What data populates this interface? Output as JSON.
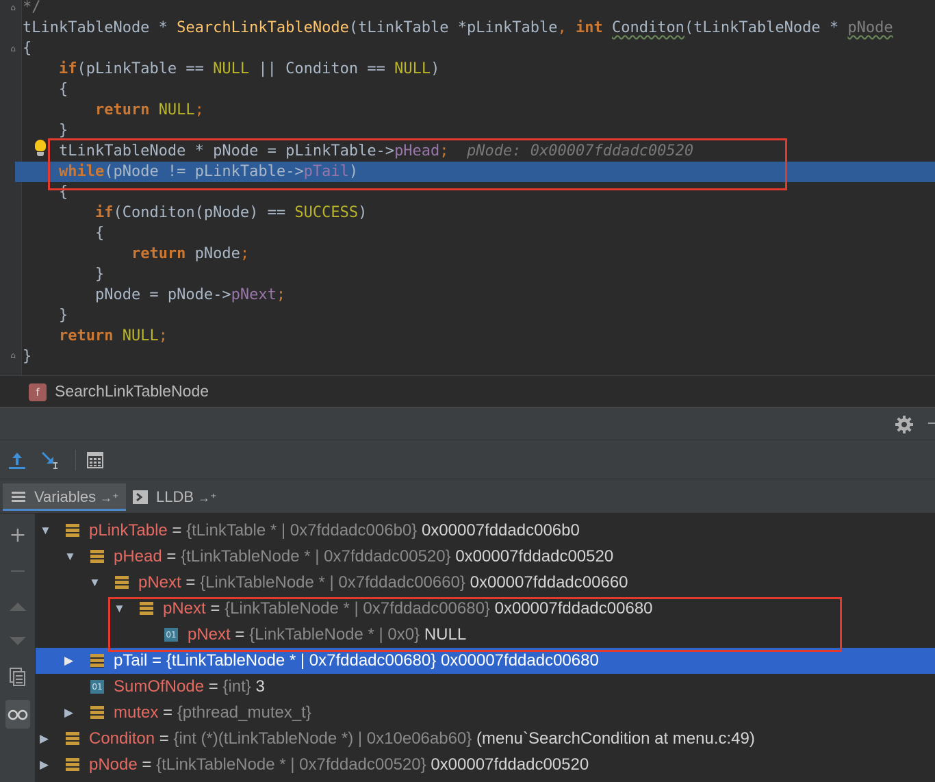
{
  "editor": {
    "lines": [
      {
        "parts": [
          {
            "t": "*/",
            "c": "cmt"
          }
        ]
      },
      {
        "parts": [
          {
            "t": "tLinkTableNode * ",
            "c": "pl"
          },
          {
            "t": "SearchLinkTableNode",
            "c": "fn"
          },
          {
            "t": "(tLinkTable *pLinkTable",
            "c": "pl"
          },
          {
            "t": ", ",
            "c": "punct"
          },
          {
            "t": "int ",
            "c": "kw"
          },
          {
            "t": "Conditon",
            "c": "pl squig"
          },
          {
            "t": "(tLinkTableNode * ",
            "c": "pl"
          },
          {
            "t": "pNode",
            "c": "cmt squig"
          }
        ]
      },
      {
        "parts": [
          {
            "t": "{",
            "c": "pl"
          }
        ]
      },
      {
        "parts": [
          {
            "t": "    ",
            "c": "pl"
          },
          {
            "t": "if",
            "c": "kw"
          },
          {
            "t": "(pLinkTable == ",
            "c": "pl"
          },
          {
            "t": "NULL",
            "c": "mac"
          },
          {
            "t": " || Conditon == ",
            "c": "pl"
          },
          {
            "t": "NULL",
            "c": "mac"
          },
          {
            "t": ")",
            "c": "pl"
          }
        ]
      },
      {
        "parts": [
          {
            "t": "    {",
            "c": "pl"
          }
        ]
      },
      {
        "parts": [
          {
            "t": "        ",
            "c": "pl"
          },
          {
            "t": "return ",
            "c": "kw"
          },
          {
            "t": "NULL",
            "c": "mac"
          },
          {
            "t": ";",
            "c": "punct"
          }
        ]
      },
      {
        "parts": [
          {
            "t": "    }",
            "c": "pl"
          }
        ]
      },
      {
        "parts": [
          {
            "t": "    tLinkTableNode * pNode = pLinkTable->",
            "c": "pl"
          },
          {
            "t": "pHead",
            "c": "fld"
          },
          {
            "t": ";",
            "c": "punct"
          },
          {
            "t": "  pNode: 0x00007fddadc00520",
            "c": "inlay"
          }
        ]
      },
      {
        "parts": [
          {
            "t": "    ",
            "c": "pl"
          },
          {
            "t": "while",
            "c": "kwb"
          },
          {
            "t": "(pNode != pLinkTable->",
            "c": "pl"
          },
          {
            "t": "pTail",
            "c": "fld"
          },
          {
            "t": ")",
            "c": "pl"
          }
        ]
      },
      {
        "parts": [
          {
            "t": "    {",
            "c": "pl"
          }
        ]
      },
      {
        "parts": [
          {
            "t": "        ",
            "c": "pl"
          },
          {
            "t": "if",
            "c": "kw"
          },
          {
            "t": "(Conditon(pNode) == ",
            "c": "pl"
          },
          {
            "t": "SUCCESS",
            "c": "mac"
          },
          {
            "t": ")",
            "c": "pl"
          }
        ]
      },
      {
        "parts": [
          {
            "t": "        {",
            "c": "pl"
          }
        ]
      },
      {
        "parts": [
          {
            "t": "            ",
            "c": "pl"
          },
          {
            "t": "return ",
            "c": "kw"
          },
          {
            "t": "pNode",
            "c": "pl"
          },
          {
            "t": ";",
            "c": "punct"
          }
        ]
      },
      {
        "parts": [
          {
            "t": "        }",
            "c": "pl"
          }
        ]
      },
      {
        "parts": [
          {
            "t": "        pNode = pNode->",
            "c": "pl"
          },
          {
            "t": "pNext",
            "c": "fld"
          },
          {
            "t": ";",
            "c": "punct"
          }
        ]
      },
      {
        "parts": [
          {
            "t": "    }",
            "c": "pl"
          }
        ]
      },
      {
        "parts": [
          {
            "t": "    ",
            "c": "pl"
          },
          {
            "t": "return ",
            "c": "kw"
          },
          {
            "t": "NULL",
            "c": "mac"
          },
          {
            "t": ";",
            "c": "punct"
          }
        ]
      },
      {
        "parts": [
          {
            "t": "}",
            "c": "pl"
          }
        ]
      }
    ],
    "execution_line_index": 8
  },
  "breadcrumb": {
    "icon_letter": "f",
    "function_name": "SearchLinkTableNode"
  },
  "tabs": {
    "variables": "Variables",
    "lldb": "LLDB",
    "pin_glyph": "→⁺"
  },
  "variables": [
    {
      "expanded": true,
      "has_children": true,
      "icon": "object",
      "name": "pLinkTable",
      "type": "{tLinkTable * | 0x7fddadc006b0}",
      "value": "0x00007fddadc006b0",
      "depth": 0
    },
    {
      "expanded": true,
      "has_children": true,
      "icon": "object",
      "name": "pHead",
      "type": "{tLinkTableNode * | 0x7fddadc00520}",
      "value": "0x00007fddadc00520",
      "depth": 1
    },
    {
      "expanded": true,
      "has_children": true,
      "icon": "object",
      "name": "pNext",
      "type": "{LinkTableNode * | 0x7fddadc00660}",
      "value": "0x00007fddadc00660",
      "depth": 2
    },
    {
      "expanded": true,
      "has_children": true,
      "icon": "object",
      "name": "pNext",
      "type": "{LinkTableNode * | 0x7fddadc00680}",
      "value": "0x00007fddadc00680",
      "depth": 3
    },
    {
      "expanded": false,
      "has_children": false,
      "icon": "primitive",
      "name": "pNext",
      "type": "{LinkTableNode * | 0x0}",
      "value": "NULL",
      "depth": 4
    },
    {
      "expanded": false,
      "has_children": true,
      "icon": "object",
      "name": "pTail",
      "type": "{tLinkTableNode * | 0x7fddadc00680}",
      "value": "0x00007fddadc00680",
      "depth": 1,
      "selected": true
    },
    {
      "expanded": false,
      "has_children": false,
      "icon": "primitive",
      "name": "SumOfNode",
      "type": "{int}",
      "value": "3",
      "depth": 1
    },
    {
      "expanded": false,
      "has_children": true,
      "icon": "object",
      "name": "mutex",
      "type": "{pthread_mutex_t}",
      "value": "",
      "depth": 1
    },
    {
      "expanded": false,
      "has_children": true,
      "icon": "object",
      "name": "Conditon",
      "type": "{int (*)(tLinkTableNode *) | 0x10e06ab60}",
      "value": "(menu`SearchCondition at menu.c:49)",
      "depth": 0
    },
    {
      "expanded": false,
      "has_children": true,
      "icon": "object",
      "name": "pNode",
      "type": "{tLinkTableNode * | 0x7fddadc00520}",
      "value": "0x00007fddadc00520",
      "depth": 0
    }
  ],
  "icons": {
    "primitive_label": "01",
    "expanded_glyph": "▼",
    "collapsed_glyph": "▶",
    "add_glyph": "+"
  },
  "colors": {
    "execution_line": "#2d5c98",
    "selected_row": "#2f65ca",
    "highlight_box": "#e23b2e",
    "variable_name": "#e46a62"
  }
}
